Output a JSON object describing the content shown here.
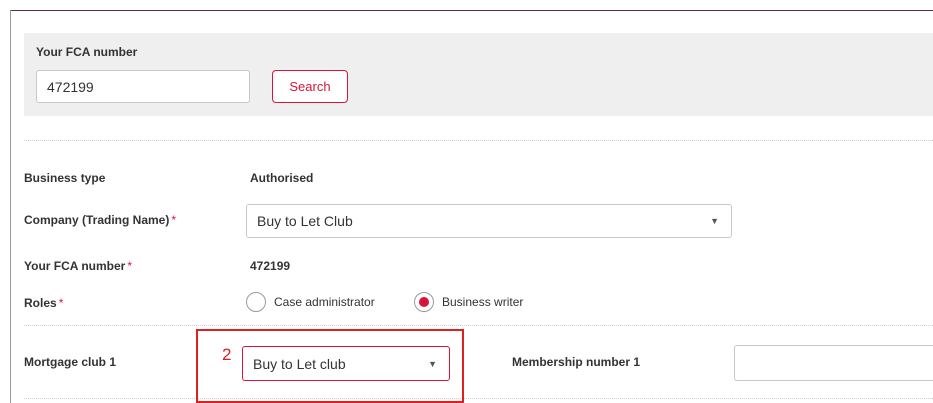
{
  "fca_panel": {
    "label": "Your FCA number",
    "input_value": "472199",
    "search_label": "Search"
  },
  "business_type": {
    "label": "Business type",
    "value": "Authorised"
  },
  "company": {
    "label": "Company (Trading Name)",
    "required_mark": "*",
    "selected": "Buy to Let Club"
  },
  "fca_number": {
    "label": "Your FCA number",
    "required_mark": "*",
    "value": "472199"
  },
  "roles": {
    "label": "Roles",
    "required_mark": "*",
    "options": [
      "Case administrator",
      "Business writer"
    ],
    "selected": "Business writer"
  },
  "mortgage_club": {
    "label": "Mortgage club 1",
    "selected": "Buy to Let club",
    "membership_label": "Membership number 1",
    "membership_value": ""
  },
  "annotation": {
    "step": "2",
    "color": "#e02020"
  },
  "colors": {
    "accent": "#d8143a",
    "panel_bg": "#efefef"
  }
}
